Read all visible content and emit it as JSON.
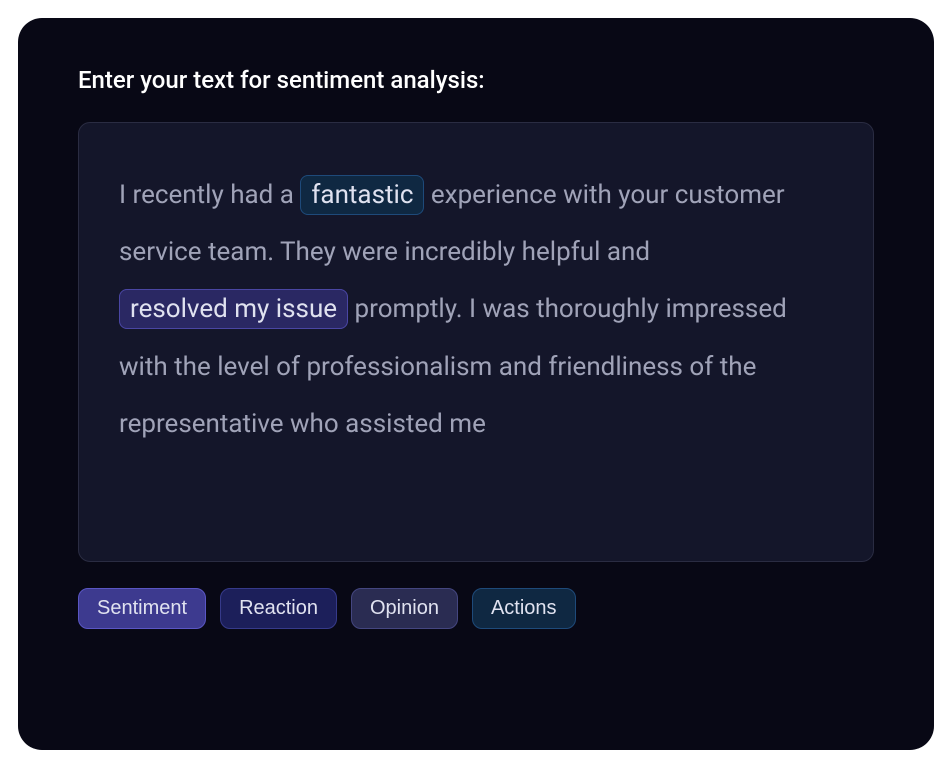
{
  "prompt": "Enter your text for sentiment analysis:",
  "text": {
    "part1": "I recently had a ",
    "highlight1": "fantastic",
    "part2": " experience with your customer service team. They were incredibly helpful and ",
    "highlight2": "resolved my issue",
    "part3": " promptly. I was thoroughly impressed with the level of professionalism and friendliness of the representative who assisted me"
  },
  "buttons": {
    "sentiment": "Sentiment",
    "reaction": "Reaction",
    "opinion": "Opinion",
    "actions": "Actions"
  }
}
